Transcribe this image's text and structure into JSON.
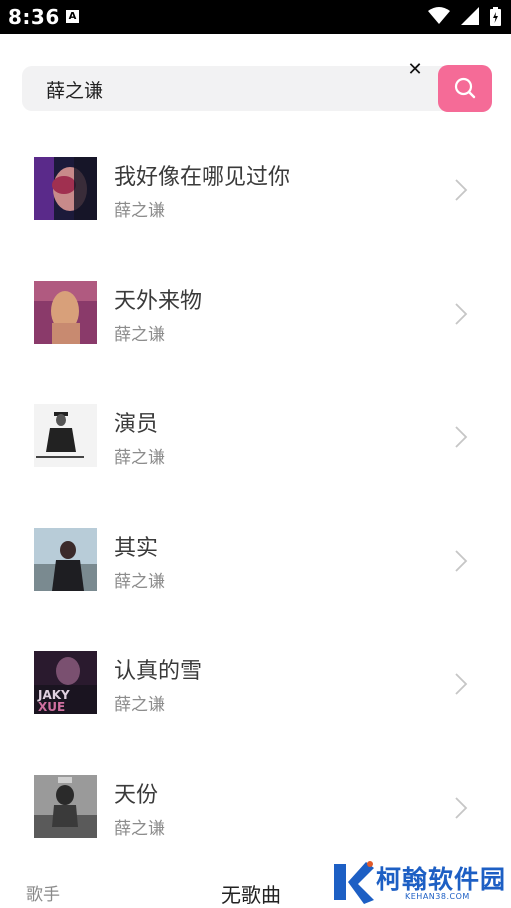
{
  "status_bar": {
    "time": "8:36",
    "notification_icon": "A"
  },
  "search": {
    "query": "薛之谦",
    "clear_label": "✕",
    "button_icon": "search-icon"
  },
  "songs": [
    {
      "title": "我好像在哪见过你",
      "artist": "薛之谦"
    },
    {
      "title": "天外来物",
      "artist": "薛之谦"
    },
    {
      "title": "演员",
      "artist": "薛之谦"
    },
    {
      "title": "其实",
      "artist": "薛之谦"
    },
    {
      "title": "认真的雪",
      "artist": "薛之谦"
    },
    {
      "title": "天份",
      "artist": "薛之谦"
    }
  ],
  "bottom": {
    "singer_tab": "歌手",
    "no_song": "无歌曲"
  },
  "watermark": {
    "cn": "柯翰软件园",
    "en": "KEHAN38.COM"
  },
  "colors": {
    "accent": "#f56b97",
    "watermark": "#1d5fc4"
  }
}
